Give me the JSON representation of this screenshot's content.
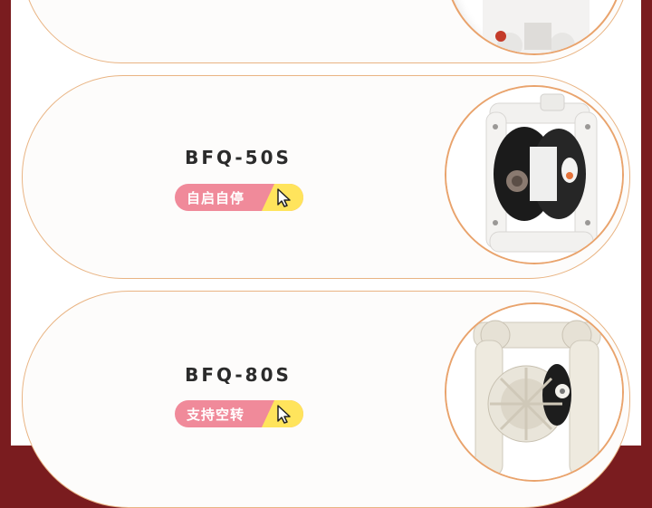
{
  "products": [
    {
      "model": "",
      "tag": ""
    },
    {
      "model": "BFQ-50S",
      "tag": "自启自停",
      "tag_color": "#f08a9a",
      "accent": "#ffe45c"
    },
    {
      "model": "BFQ-80S",
      "tag": "支持空转",
      "tag_color": "#f08a9a",
      "accent": "#ffe45c"
    }
  ],
  "icons": {
    "tag_icon": "cursor-pointer-icon",
    "product_photo": "diaphragm-pump-image"
  },
  "colors": {
    "frame": "#7a1c1f",
    "card_border": "#e9b483",
    "photo_ring": "#e9a36c"
  }
}
